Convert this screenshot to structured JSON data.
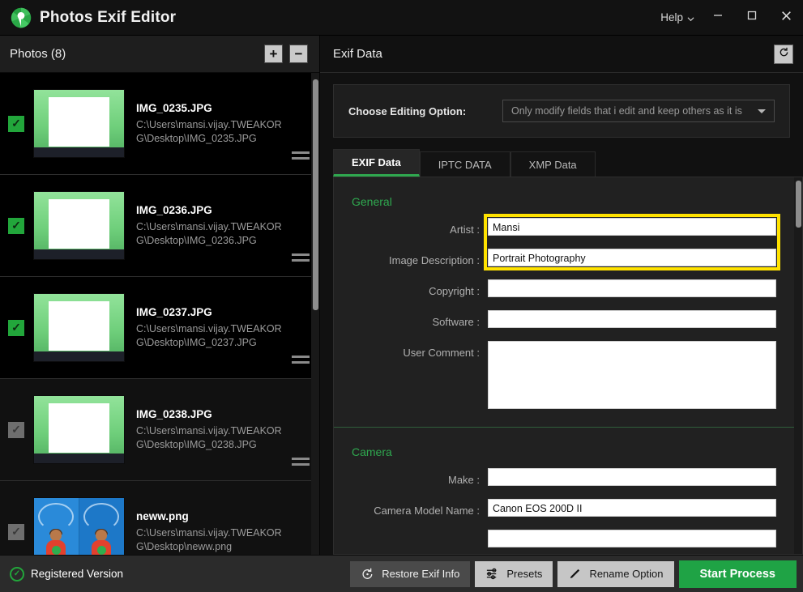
{
  "window": {
    "app_title": "Photos Exif Editor",
    "logo_icon": "aperture-logo-icon",
    "help_label": "Help",
    "minimize_icon": "minimize-icon",
    "maximize_icon": "maximize-icon",
    "close_icon": "close-icon"
  },
  "left_panel": {
    "title": "Photos (8)",
    "add_label": "+",
    "remove_label": "−",
    "items": [
      {
        "name": "IMG_0235.JPG",
        "path_line1": "C:\\Users\\mansi.vijay.TWEAKORG",
        "path_line2": "\\Desktop\\IMG_0235.JPG",
        "checked": true,
        "selected": true,
        "thumb": "green-board"
      },
      {
        "name": "IMG_0236.JPG",
        "path_line1": "C:\\Users\\mansi.vijay.TWEAKORG",
        "path_line2": "\\Desktop\\IMG_0236.JPG",
        "checked": true,
        "selected": true,
        "thumb": "green-board"
      },
      {
        "name": "IMG_0237.JPG",
        "path_line1": "C:\\Users\\mansi.vijay.TWEAKORG",
        "path_line2": "\\Desktop\\IMG_0237.JPG",
        "checked": true,
        "selected": true,
        "thumb": "green-board"
      },
      {
        "name": "IMG_0238.JPG",
        "path_line1": "C:\\Users\\mansi.vijay.TWEAKORG",
        "path_line2": "\\Desktop\\IMG_0238.JPG",
        "checked": false,
        "selected": false,
        "thumb": "green-board"
      },
      {
        "name": "neww.png",
        "path_line1": "C:\\Users\\mansi.vijay.TWEAKORG",
        "path_line2": "\\Desktop\\neww.png",
        "checked": false,
        "selected": false,
        "thumb": "blue-illustration"
      }
    ]
  },
  "right_panel": {
    "title": "Exif Data",
    "reset_icon": "reset-arrow-icon",
    "editing_option": {
      "label": "Choose Editing Option:",
      "value": "Only modify fields that i edit and keep others as it is"
    },
    "tabs": [
      {
        "label": "EXIF Data",
        "active": true
      },
      {
        "label": "IPTC DATA",
        "active": false
      },
      {
        "label": "XMP Data",
        "active": false
      }
    ],
    "sections": [
      {
        "title": "General",
        "fields": [
          {
            "label": "Artist :",
            "value": "Mansi",
            "type": "text",
            "highlighted": true
          },
          {
            "label": "Image Description :",
            "value": "Portrait Photography",
            "type": "text",
            "highlighted": true
          },
          {
            "label": "Copyright :",
            "value": "",
            "type": "text",
            "highlighted": false
          },
          {
            "label": "Software :",
            "value": "",
            "type": "text",
            "highlighted": false
          },
          {
            "label": "User Comment :",
            "value": "",
            "type": "textarea",
            "highlighted": false
          }
        ]
      },
      {
        "title": "Camera",
        "fields": [
          {
            "label": "Make :",
            "value": "",
            "type": "text",
            "highlighted": false
          },
          {
            "label": "Camera Model Name :",
            "value": "Canon EOS 200D II",
            "type": "text",
            "highlighted": false
          },
          {
            "label": "",
            "value": "",
            "type": "text",
            "highlighted": false
          }
        ]
      }
    ],
    "highlight_color": "#ffe200",
    "accent_color": "#2fa84f"
  },
  "bottom_bar": {
    "registered_label": "Registered Version",
    "registered_icon": "check-circle-icon",
    "buttons": [
      {
        "label": "Restore Exif Info",
        "icon": "restore-clock-icon",
        "style": "dark"
      },
      {
        "label": "Presets",
        "icon": "sliders-icon",
        "style": "light"
      },
      {
        "label": "Rename Option",
        "icon": "pencil-icon",
        "style": "light"
      },
      {
        "label": "Start Process",
        "icon": "",
        "style": "green"
      }
    ]
  }
}
